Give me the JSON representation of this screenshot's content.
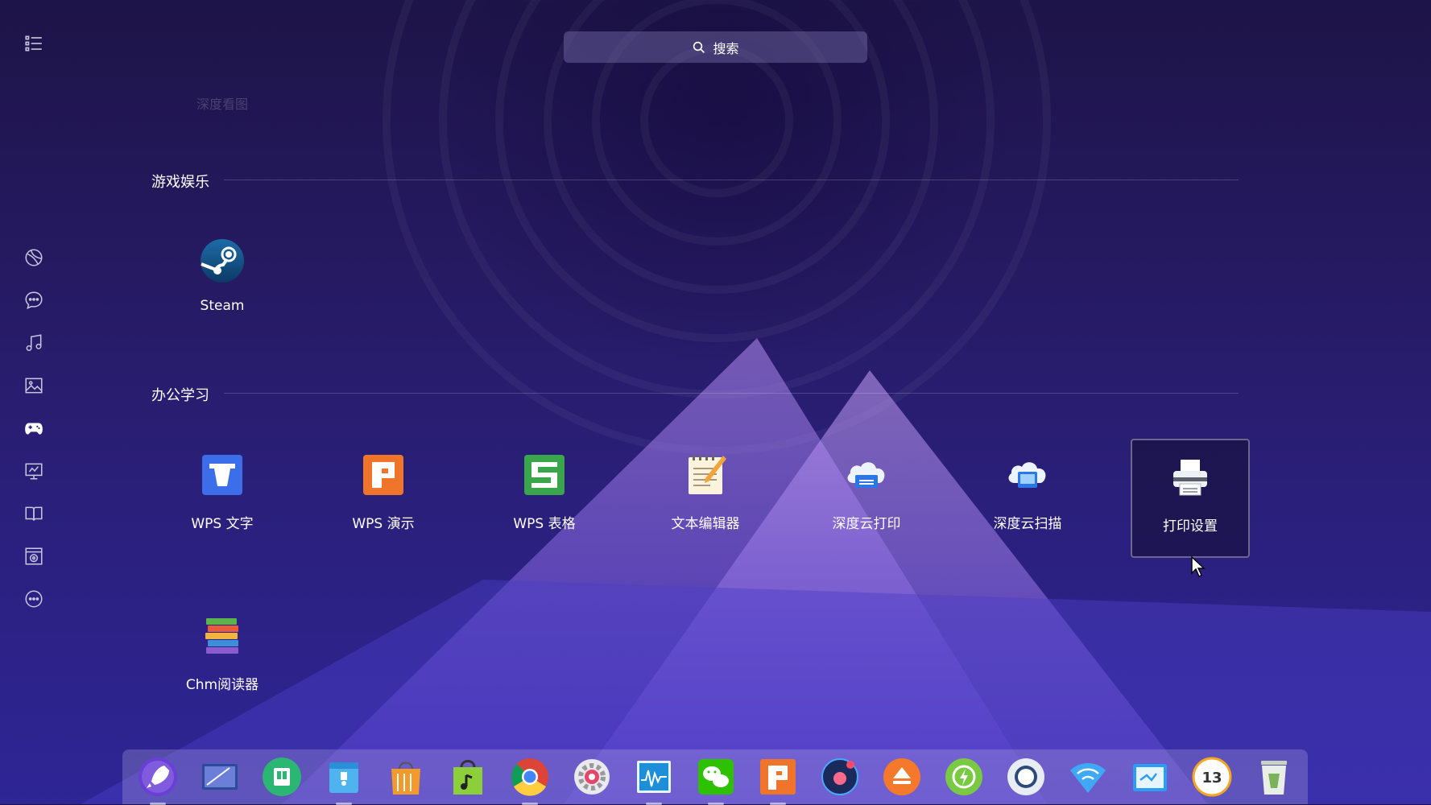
{
  "search": {
    "label": "搜索"
  },
  "faded_header": "深度看图",
  "sections": {
    "games": {
      "title": "游戏娱乐",
      "apps": [
        {
          "label": "Steam"
        }
      ]
    },
    "office": {
      "title": "办公学习",
      "apps": [
        {
          "label": "WPS 文字"
        },
        {
          "label": "WPS 演示"
        },
        {
          "label": "WPS 表格"
        },
        {
          "label": "文本编辑器"
        },
        {
          "label": "深度云打印"
        },
        {
          "label": "深度云扫描"
        },
        {
          "label": "打印设置"
        },
        {
          "label": "Chm阅读器"
        }
      ]
    }
  },
  "sidebar": {
    "items": [
      {
        "icon": "list-view-icon"
      },
      {
        "icon": "internet-icon"
      },
      {
        "icon": "chat-icon"
      },
      {
        "icon": "music-icon"
      },
      {
        "icon": "image-icon"
      },
      {
        "icon": "gamepad-icon"
      },
      {
        "icon": "office-icon"
      },
      {
        "icon": "reading-icon"
      },
      {
        "icon": "system-icon"
      },
      {
        "icon": "others-icon"
      }
    ]
  },
  "dock": {
    "items": [
      {
        "icon": "launcher-icon"
      },
      {
        "icon": "multitask-view-icon"
      },
      {
        "icon": "file-manager-icon"
      },
      {
        "icon": "file-icon"
      },
      {
        "icon": "app-store-icon"
      },
      {
        "icon": "music-player-icon"
      },
      {
        "icon": "chrome-icon"
      },
      {
        "icon": "settings-icon"
      },
      {
        "icon": "system-monitor-icon"
      },
      {
        "icon": "wechat-icon"
      },
      {
        "icon": "wps-presentation-icon"
      },
      {
        "icon": "camera-icon"
      },
      {
        "icon": "eject-icon"
      },
      {
        "icon": "power-icon"
      },
      {
        "icon": "capture-icon"
      },
      {
        "icon": "wifi-icon"
      },
      {
        "icon": "screenshot-icon"
      },
      {
        "icon": "clock-icon",
        "text": "13"
      },
      {
        "icon": "trash-icon"
      }
    ]
  },
  "colors": {
    "accent": "#2b1f78",
    "wps_word": "#3b6ee8",
    "wps_present": "#f0752a",
    "wps_sheet": "#3aa64b"
  }
}
